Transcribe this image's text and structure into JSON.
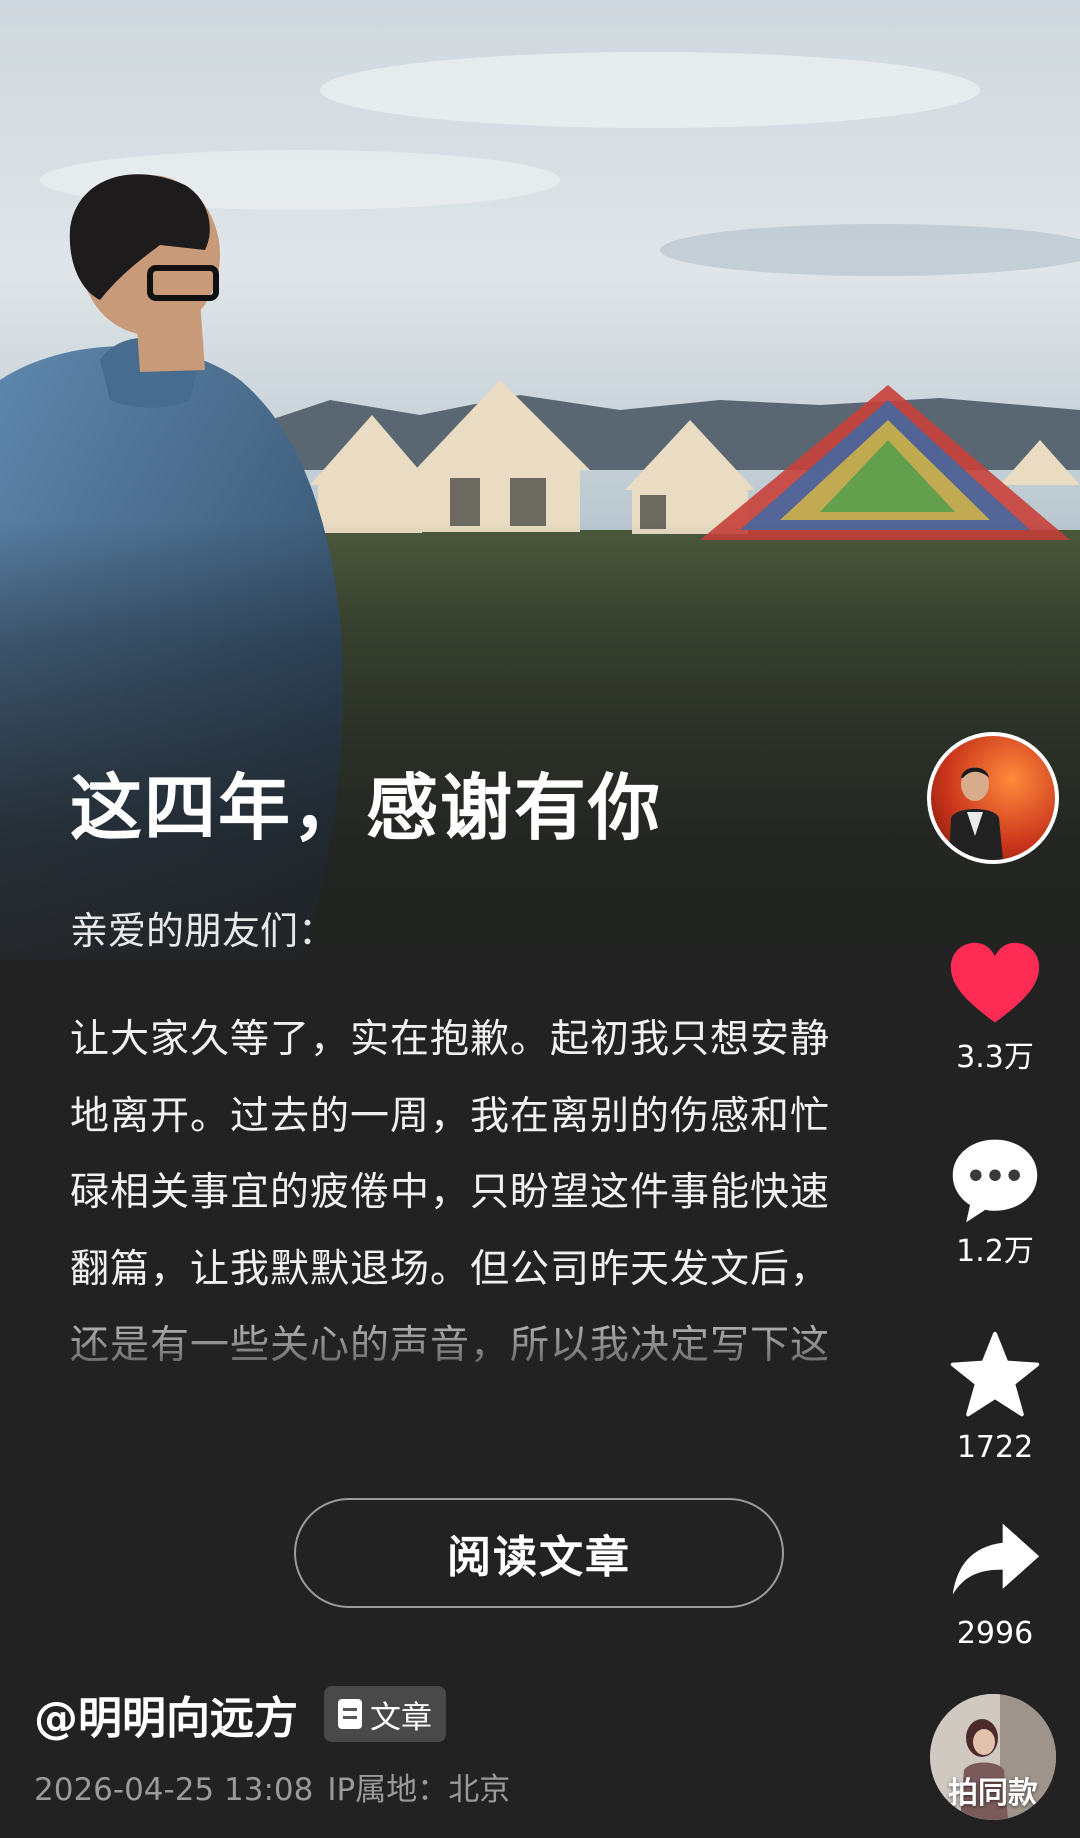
{
  "article": {
    "title": "这四年，感谢有你",
    "greeting": "亲爱的朋友们：",
    "body": "让大家久等了，实在抱歉。起初我只想安静地离开。过去的一周，我在离别的伤感和忙碌相关事宜的疲倦中，只盼望这件事能快速翻篇，让我默默退场。但公司昨天发文后，还是有一些关心的声音，所以我决定写下这封信，正式地和大家说一声再",
    "read_button_label": "阅读文章"
  },
  "author": {
    "name": "@明明向远方",
    "badge_label": "文章",
    "badge_icon": "document-icon"
  },
  "meta": {
    "datetime": "2026-04-25 13:08",
    "ip_location": "IP属地：北京"
  },
  "actions": {
    "like": {
      "icon": "heart-icon",
      "count": "3.3万",
      "color": "#fe2c55"
    },
    "comment": {
      "icon": "comment-icon",
      "count": "1.2万"
    },
    "favorite": {
      "icon": "star-icon",
      "count": "1722"
    },
    "share": {
      "icon": "share-icon",
      "count": "2996"
    }
  },
  "same_style": {
    "label": "拍同款"
  }
}
